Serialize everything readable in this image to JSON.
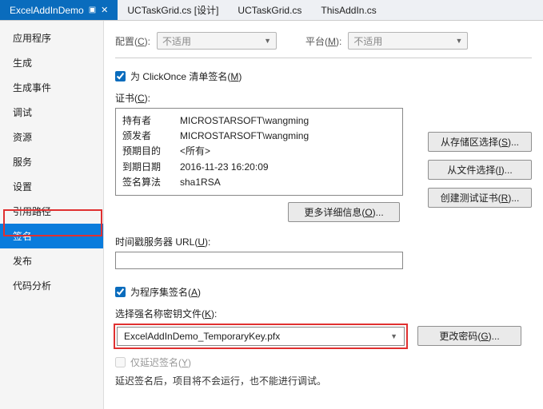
{
  "tabs": {
    "active": "ExcelAddInDemo",
    "t1": "UCTaskGrid.cs [设计]",
    "t2": "UCTaskGrid.cs",
    "t3": "ThisAddIn.cs"
  },
  "sidebar": {
    "items": [
      "应用程序",
      "生成",
      "生成事件",
      "调试",
      "资源",
      "服务",
      "设置",
      "引用路径",
      "签名",
      "发布",
      "代码分析"
    ],
    "active_index": 8
  },
  "top": {
    "config_label": "配置(",
    "config_key": "C",
    "config_suffix": "):",
    "config_value": "不适用",
    "platform_label": "平台(",
    "platform_key": "M",
    "platform_suffix": "):",
    "platform_value": "不适用"
  },
  "clickonce": {
    "checked": true,
    "label_prefix": "为 ClickOnce 清单签名(",
    "label_key": "M",
    "label_suffix": ")"
  },
  "cert": {
    "label_prefix": "证书(",
    "label_key": "C",
    "label_suffix": "):",
    "owner_l": "持有者",
    "owner_v": "MICROSTARSOFT\\wangming",
    "issuer_l": "颁发者",
    "issuer_v": "MICROSTARSOFT\\wangming",
    "purpose_l": "预期目的",
    "purpose_v": "<所有>",
    "expire_l": "到期日期",
    "expire_v": "2016-11-23 16:20:09",
    "alg_l": "签名算法",
    "alg_v": "sha1RSA"
  },
  "buttons": {
    "from_store": "从存储区选择(",
    "from_store_key": "S",
    "from_file": "从文件选择(",
    "from_file_key": "I",
    "create_test": "创建测试证书(",
    "create_test_key": "R",
    "more": "更多详细信息(",
    "more_key": "O",
    "change_pwd": "更改密码(",
    "change_pwd_key": "G",
    "ellipsis": ")..."
  },
  "timestamp": {
    "label_prefix": "时间戳服务器 URL(",
    "label_key": "U",
    "label_suffix": "):",
    "value": ""
  },
  "assembly": {
    "checked": true,
    "label_prefix": "为程序集签名(",
    "label_key": "A",
    "label_suffix": ")",
    "keyfile_label_prefix": "选择强名称密钥文件(",
    "keyfile_label_key": "K",
    "keyfile_label_suffix": "):",
    "keyfile_value": "ExcelAddInDemo_TemporaryKey.pfx",
    "delay_label_prefix": "仅延迟签名(",
    "delay_label_key": "Y",
    "delay_label_suffix": ")",
    "delay_note": "延迟签名后，项目将不会运行，也不能进行调试。"
  }
}
